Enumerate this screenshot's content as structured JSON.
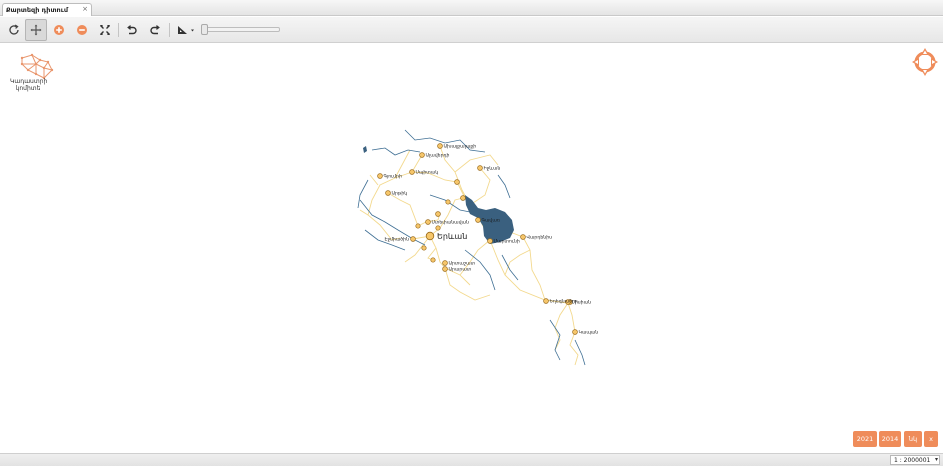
{
  "tab": {
    "label": "Քարտեզի դիտում"
  },
  "toolbar": {
    "tools": [
      "refresh-icon",
      "pan-icon",
      "zoom-in-icon",
      "zoom-out-icon",
      "full-extent-icon",
      "undo-icon",
      "redo-icon",
      "measure-icon"
    ],
    "accent": "#ef8c5a"
  },
  "logo": {
    "line1": "Կադաստրի",
    "line2": "կոմիտե"
  },
  "map": {
    "lake_color": "#3a607f",
    "road_color": "#f3d98e",
    "river_color": "#3f6f94",
    "capital": {
      "name": "Երևան"
    },
    "cities": [
      {
        "name": "Ախալքալաքի"
      },
      {
        "name": "Ալավերդի"
      },
      {
        "name": "Իջևան"
      },
      {
        "name": "Գյումրի"
      },
      {
        "name": "Սպիտակ"
      },
      {
        "name": "Արթիկ"
      },
      {
        "name": "Հրազդան"
      },
      {
        "name": "Սևան"
      },
      {
        "name": "Գավառ"
      },
      {
        "name": "Էջմիածին"
      },
      {
        "name": "Մարտունի"
      },
      {
        "name": "Վարդենիս"
      },
      {
        "name": "Արտաշատ"
      },
      {
        "name": "Արարատ"
      },
      {
        "name": "Եղեգնաձոր"
      },
      {
        "name": "Սիսիան"
      },
      {
        "name": "Գորիս"
      },
      {
        "name": "Կապան"
      },
      {
        "name": "Ստեփանավան"
      },
      {
        "name": "Վանաձոր"
      }
    ]
  },
  "year_buttons": [
    "2021",
    "2014",
    "նկ",
    "x"
  ],
  "status": {
    "scale": "1 : 2000001"
  }
}
